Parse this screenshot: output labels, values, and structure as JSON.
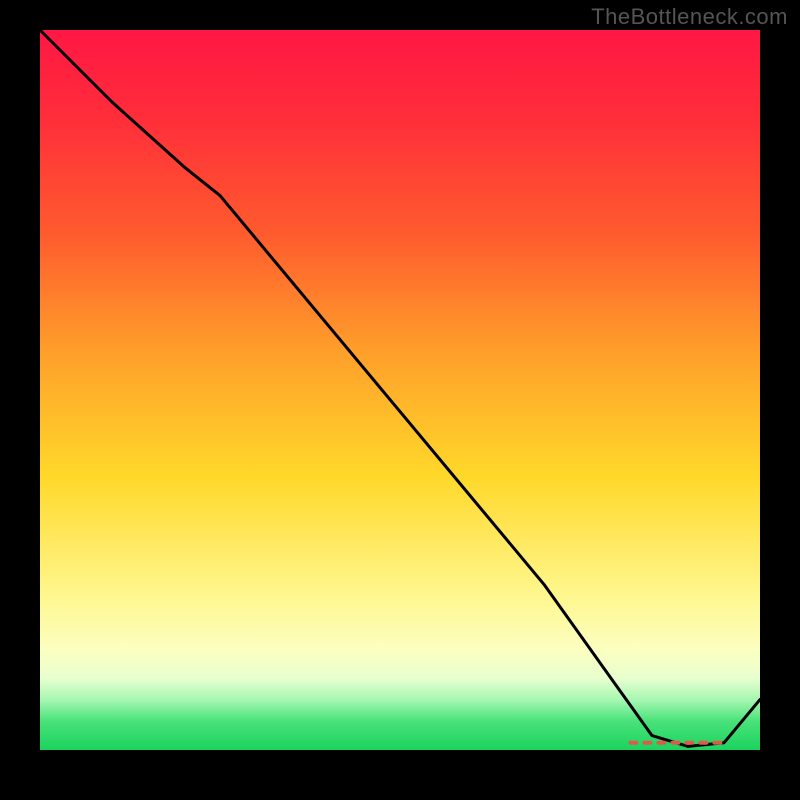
{
  "watermark_text": "TheBottleneck.com",
  "gradient_stops": [
    {
      "pos": 0,
      "color": "#ff1744"
    },
    {
      "pos": 12,
      "color": "#ff2d3a"
    },
    {
      "pos": 28,
      "color": "#ff5a2e"
    },
    {
      "pos": 45,
      "color": "#ffa02a"
    },
    {
      "pos": 62,
      "color": "#ffd82a"
    },
    {
      "pos": 78,
      "color": "#fff68a"
    },
    {
      "pos": 86,
      "color": "#fcffc0"
    },
    {
      "pos": 90,
      "color": "#e8ffcf"
    },
    {
      "pos": 93,
      "color": "#a7f7b2"
    },
    {
      "pos": 96,
      "color": "#49e27a"
    },
    {
      "pos": 100,
      "color": "#1bd35e"
    }
  ],
  "chart_data": {
    "type": "line",
    "title": "",
    "xlabel": "",
    "ylabel": "",
    "x_range": [
      0,
      100
    ],
    "y_range": [
      0,
      100
    ],
    "x": [
      0,
      10,
      20,
      25,
      30,
      40,
      50,
      60,
      70,
      80,
      85,
      90,
      95,
      100
    ],
    "values": [
      100,
      90,
      81,
      77,
      71,
      59,
      47,
      35,
      23,
      9,
      2,
      0.5,
      1,
      7
    ],
    "note": "y is percent of full height (0 = bottom green band, 100 = top). Single black curve descends steeply from top-left, nearly linearly through the middle, bottoms out around x≈88–92 at y≈0–1, then rises slightly at the far right. A short dashed red segment sits on the valley floor roughly x∈[82,95] at y≈1.",
    "marker_segment": {
      "style": "dashed",
      "color": "#e05a4a",
      "x_start": 82,
      "x_end": 95,
      "y": 1
    }
  }
}
